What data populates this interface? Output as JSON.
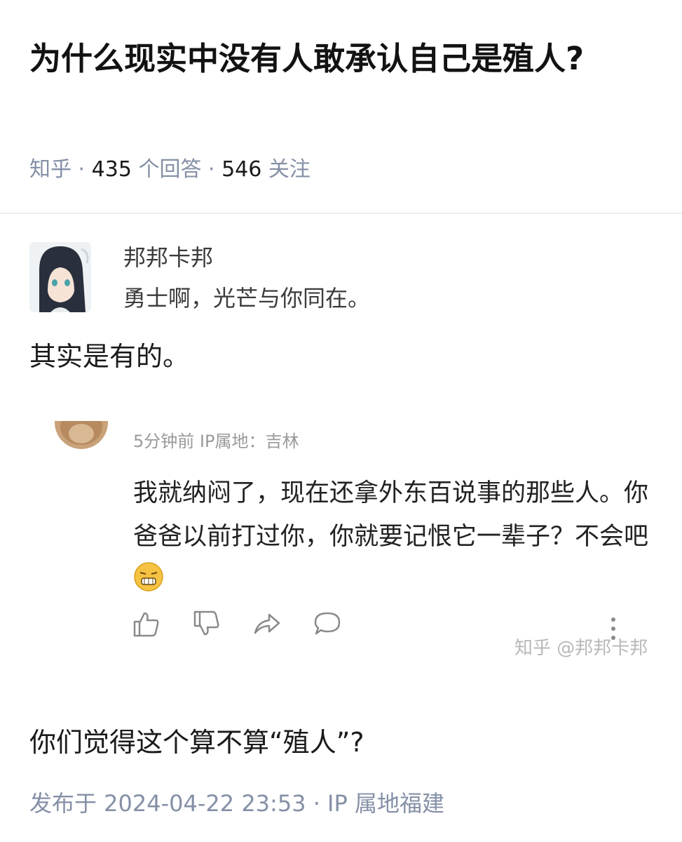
{
  "question": {
    "title": "为什么现实中没有人敢承认自己是殖人?",
    "source": "知乎",
    "sep": "·",
    "answer_count": "435",
    "answer_label": "个回答",
    "follow_count": "546",
    "follow_label": "关注"
  },
  "author": {
    "name": "邦邦卡邦",
    "bio": "勇士啊，光芒与你同在。"
  },
  "answer": {
    "paragraph_1": "其实是有的。",
    "embedded_comment": {
      "meta": "5分钟前  IP属地：吉林",
      "text": "我就纳闷了，现在还拿外东百说事的那些人。你爸爸以前打过你，你就要记恨它一辈子？不会吧",
      "watermark": "知乎 @邦邦卡邦"
    },
    "paragraph_2": "你们觉得这个算不算“殖人”?",
    "published": "发布于 2024-04-22 23:53 · IP 属地福建"
  },
  "colors": {
    "meta_gray": "#8590a6",
    "text": "#1a1a1a",
    "emoji_yellow": "#f5c242"
  },
  "icons": [
    "like-icon",
    "dislike-icon",
    "share-icon",
    "comment-icon",
    "more-icon",
    "grimace-emoji-icon"
  ]
}
